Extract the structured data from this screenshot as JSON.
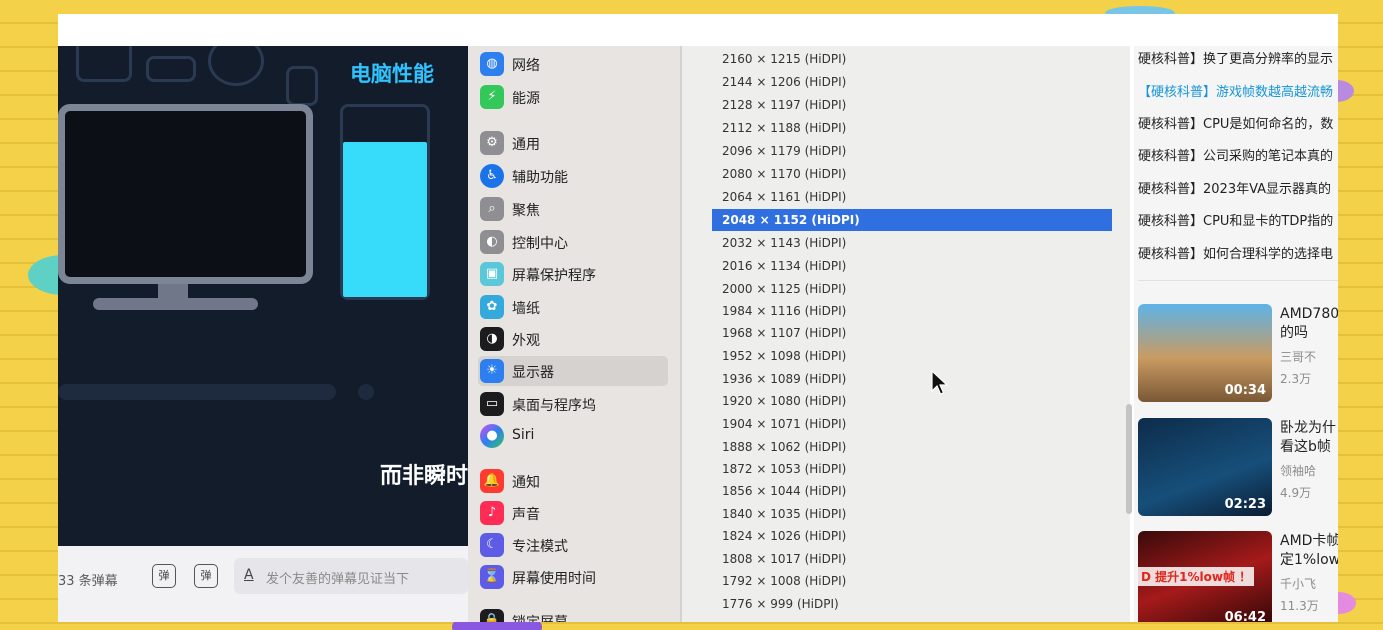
{
  "colors": {
    "selection": "#2f6fe0",
    "accent_cyan": "#30c4ff",
    "link": "#1496d6"
  },
  "video": {
    "title": "电脑性能",
    "subtitle": "而非瞬时"
  },
  "danmaku": {
    "count": "33 条弹幕",
    "btn1": "弹",
    "btn2": "弹",
    "input_icon": "A",
    "placeholder": "发个友善的弹幕见证当下"
  },
  "sidebar": {
    "items": [
      {
        "label": "网络",
        "icon": "globe-icon"
      },
      {
        "label": "能源",
        "icon": "bolt-icon"
      },
      {
        "label": "通用",
        "icon": "gear-icon"
      },
      {
        "label": "辅助功能",
        "icon": "accessibility-icon"
      },
      {
        "label": "聚焦",
        "icon": "magnifier-icon"
      },
      {
        "label": "控制中心",
        "icon": "toggle-icon"
      },
      {
        "label": "屏幕保护程序",
        "icon": "screensaver-icon"
      },
      {
        "label": "墙纸",
        "icon": "flower-icon"
      },
      {
        "label": "外观",
        "icon": "appearance-icon"
      },
      {
        "label": "显示器",
        "icon": "sun-icon"
      },
      {
        "label": "桌面与程序坞",
        "icon": "dock-icon"
      },
      {
        "label": "Siri",
        "icon": "siri-icon"
      },
      {
        "label": "通知",
        "icon": "bell-icon"
      },
      {
        "label": "声音",
        "icon": "speaker-icon"
      },
      {
        "label": "专注模式",
        "icon": "moon-icon"
      },
      {
        "label": "屏幕使用时间",
        "icon": "hourglass-icon"
      },
      {
        "label": "锁定屏幕",
        "icon": "lock-icon"
      }
    ]
  },
  "resolutions": [
    "2160 × 1215 (HiDPI)",
    "2144 × 1206 (HiDPI)",
    "2128 × 1197 (HiDPI)",
    "2112 × 1188 (HiDPI)",
    "2096 × 1179 (HiDPI)",
    "2080 × 1170 (HiDPI)",
    "2064 × 1161 (HiDPI)",
    "2048 × 1152 (HiDPI)",
    "2032 × 1143 (HiDPI)",
    "2016 × 1134 (HiDPI)",
    "2000 × 1125 (HiDPI)",
    "1984 × 1116 (HiDPI)",
    "1968 × 1107 (HiDPI)",
    "1952 × 1098 (HiDPI)",
    "1936 × 1089 (HiDPI)",
    "1920 × 1080 (HiDPI)",
    "1904 × 1071 (HiDPI)",
    "1888 × 1062 (HiDPI)",
    "1872 × 1053 (HiDPI)",
    "1856 × 1044 (HiDPI)",
    "1840 × 1035 (HiDPI)",
    "1824 × 1026 (HiDPI)",
    "1808 × 1017 (HiDPI)",
    "1792 × 1008 (HiDPI)",
    "1776 × 999 (HiDPI)"
  ],
  "selected_resolution_index": 7,
  "articles": [
    "硬核科普】换了更高分辨率的显示",
    "【硬核科普】游戏帧数越高越流畅",
    "硬核科普】CPU是如何命名的，数",
    "硬核科普】公司采购的笔记本真的",
    "硬核科普】2023年VA显示器真的",
    "硬核科普】CPU和显卡的TDP指的",
    "硬核科普】如何合理科学的选择电"
  ],
  "videos": [
    {
      "title1": "AMD780",
      "title2": "的吗",
      "up": "三哥不",
      "views": "2.3万",
      "duration": "00:34"
    },
    {
      "title1": "卧龙为什",
      "title2": "看这b帧",
      "up": "领袖哈",
      "views": "4.9万",
      "duration": "02:23"
    },
    {
      "title1": "AMD卡帧",
      "title2": "定1%low",
      "up": "千小飞",
      "views": "11.3万",
      "duration": "06:42",
      "overlay": "D 提升1%low帧 ！"
    }
  ]
}
